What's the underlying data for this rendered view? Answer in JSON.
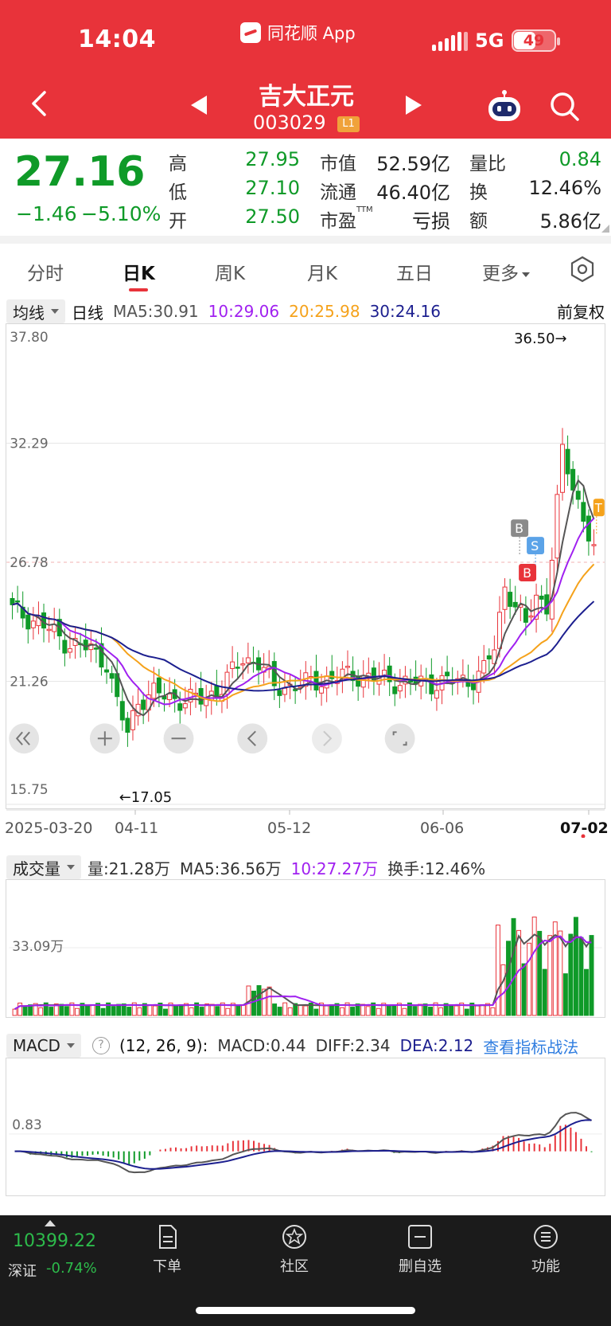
{
  "status_bar": {
    "time": "14:04",
    "app_name": "同花顺 App",
    "network": "5G",
    "battery": "49"
  },
  "header": {
    "stock_name": "吉大正元",
    "stock_code": "003029",
    "level_tag": "L1",
    "icons": [
      "back-icon",
      "prev-stock-icon",
      "next-stock-icon",
      "robot-icon",
      "search-icon"
    ]
  },
  "quote": {
    "price": "27.16",
    "change": "−1.46",
    "change_pct": "−5.10%",
    "high_label": "高",
    "high": "27.95",
    "low_label": "低",
    "low": "27.10",
    "open_label": "开",
    "open": "27.50",
    "mktcap_label": "市值",
    "mktcap": "52.59亿",
    "float_label": "流通",
    "float": "46.40亿",
    "pe_label": "市盈",
    "pe_sup": "TTM",
    "pe": "亏损",
    "volratio_label": "量比",
    "volratio": "0.84",
    "turnover_label": "换",
    "turnover": "12.46%",
    "amount_label": "额",
    "amount": "5.86亿"
  },
  "tabs": [
    "分时",
    "日K",
    "周K",
    "月K",
    "五日",
    "更多"
  ],
  "active_tab": "日K",
  "kline_header": {
    "selector": "均线",
    "period": "日线",
    "ma5": "MA5:30.91",
    "ma10": "10:29.06",
    "ma20": "20:25.98",
    "ma30": "30:24.16",
    "adjust": "前复权"
  },
  "colors": {
    "brand_red": "#e8333a",
    "down_green": "#0f9a28",
    "ma5": "#555555",
    "ma10": "#a020f0",
    "ma20": "#f5a21b",
    "ma30": "#1c1f8f"
  },
  "kline_axis": {
    "y_labels": [
      "37.80",
      "32.29",
      "26.78",
      "21.26",
      "15.75"
    ],
    "x_labels": [
      "2025-03-20",
      "04-11",
      "05-12",
      "06-06",
      "07-02"
    ],
    "high_mark": "36.50→",
    "low_mark": "←17.05",
    "trade_marks": [
      "B",
      "S",
      "B",
      "T"
    ]
  },
  "volume_header": {
    "selector": "成交量",
    "vol": "量:21.28万",
    "ma5": "MA5:36.56万",
    "ma10": "10:27.27万",
    "turnover": "换手:12.46%",
    "y_label": "33.09万"
  },
  "macd_header": {
    "selector": "MACD",
    "params": "(12, 26, 9):",
    "macd": "MACD:0.44",
    "diff": "DIFF:2.34",
    "dea": "DEA:2.12",
    "link": "查看指标战法",
    "y_label": "0.83"
  },
  "chart_data": [
    {
      "type": "candlestick",
      "title": "日线",
      "y_range": [
        15.75,
        37.8
      ],
      "x_ticks": [
        "2025-03-20",
        "04-11",
        "05-12",
        "06-06",
        "07-02"
      ],
      "highest": 36.5,
      "lowest": 17.05,
      "series": [
        {
          "name": "MA5",
          "last": 30.91
        },
        {
          "name": "MA10",
          "last": 29.06
        },
        {
          "name": "MA20",
          "last": 25.98
        },
        {
          "name": "MA30",
          "last": 24.16
        }
      ]
    },
    {
      "type": "bar",
      "title": "成交量",
      "y_ticks": [
        "33.09万"
      ],
      "series": [
        {
          "name": "MA5",
          "last": "36.56万"
        },
        {
          "name": "10",
          "last": "27.27万"
        }
      ]
    },
    {
      "type": "bar",
      "title": "MACD",
      "params": [
        12,
        26,
        9
      ],
      "y_ticks": [
        0.83
      ],
      "series": [
        {
          "name": "MACD",
          "last": 0.44
        },
        {
          "name": "DIFF",
          "last": 2.34
        },
        {
          "name": "DEA",
          "last": 2.12
        }
      ]
    }
  ],
  "chart_controls": [
    "collapse-left-icon",
    "zoom-in-icon",
    "zoom-out-icon",
    "prev-icon",
    "next-icon",
    "fullscreen-icon"
  ],
  "bottom_bar": {
    "index_value": "10399.22",
    "index_name": "深证",
    "index_pct": "-0.74%",
    "items": [
      {
        "label": "下单",
        "icon": "order-icon"
      },
      {
        "label": "社区",
        "icon": "community-icon"
      },
      {
        "label": "删自选",
        "icon": "remove-watchlist-icon"
      },
      {
        "label": "功能",
        "icon": "menu-icon"
      }
    ]
  }
}
